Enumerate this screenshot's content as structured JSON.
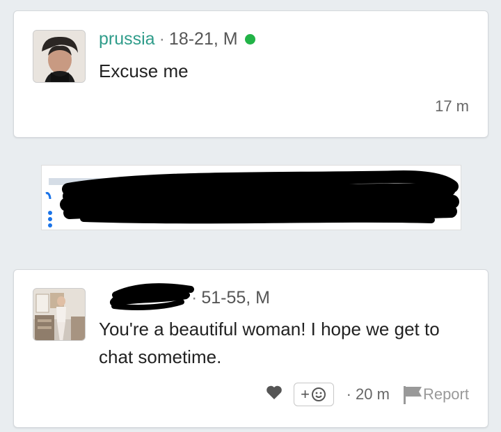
{
  "comment1": {
    "username": "prussia",
    "separator": "·",
    "age_sex": "18-21, M",
    "message": "Excuse me",
    "time": "17 m"
  },
  "comment2": {
    "separator": "·",
    "age_sex": "51-55, M",
    "message": "You're a beautiful woman! I hope we get to chat sometime.",
    "time": "· 20 m",
    "react_label": "+",
    "report_label": "Report"
  },
  "colors": {
    "username": "#2f9c8a",
    "online": "#22b347",
    "accent": "#1a73e8"
  },
  "icons": [
    "online-status-dot",
    "heart-icon",
    "emoji-icon",
    "flag-icon",
    "more-dots-icon"
  ]
}
